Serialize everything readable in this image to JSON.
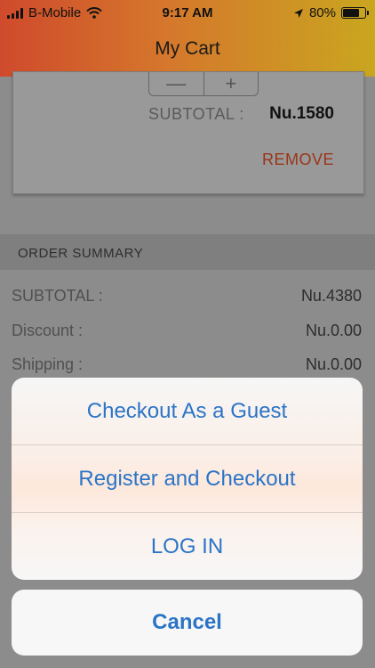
{
  "status_bar": {
    "carrier": "B-Mobile",
    "time": "9:17 AM",
    "battery": "80%",
    "battery_level": 0.8
  },
  "nav": {
    "title": "My Cart"
  },
  "cart_item": {
    "stepper_minus": "—",
    "stepper_plus": "+",
    "subtotal_label": "SUBTOTAL :",
    "subtotal_value": "Nu.1580",
    "remove_label": "REMOVE"
  },
  "order_summary": {
    "heading": "ORDER SUMMARY",
    "rows": [
      {
        "label": "SUBTOTAL :",
        "value": "Nu.4380"
      },
      {
        "label": "Discount :",
        "value": "Nu.0.00"
      },
      {
        "label": "Shipping :",
        "value": "Nu.0.00"
      }
    ]
  },
  "action_sheet": {
    "options": [
      "Checkout As a Guest",
      "Register and Checkout",
      "LOG IN"
    ],
    "cancel": "Cancel"
  },
  "colors": {
    "accent": "#2b74c6",
    "remove": "#d9532c",
    "header_start": "#cf4a2c",
    "header_end": "#c9a61f"
  }
}
